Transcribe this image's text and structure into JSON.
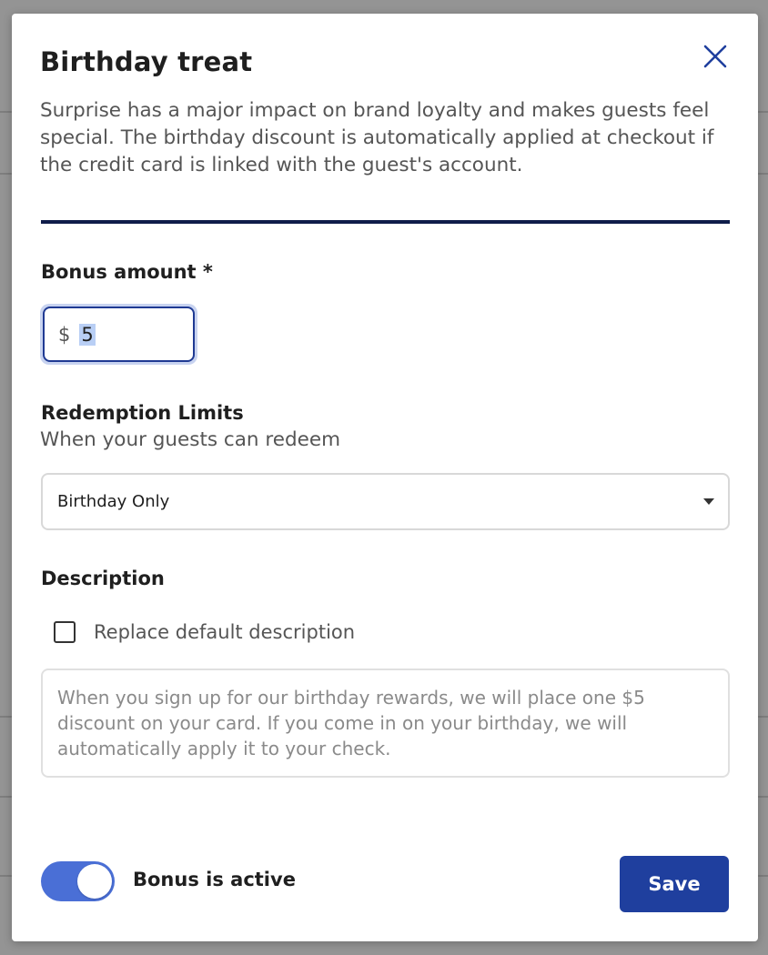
{
  "modal": {
    "title": "Birthday treat",
    "intro": "Surprise has a major impact on brand loyalty and makes guests feel special. The birthday discount is automatically applied at checkout if the credit card is linked with the guest's account."
  },
  "bonus_amount": {
    "label": "Bonus amount *",
    "prefix": "$",
    "value": "5"
  },
  "redemption": {
    "label": "Redemption Limits",
    "sublabel": "When your guests can redeem",
    "selected": "Birthday Only"
  },
  "description": {
    "label": "Description",
    "checkbox_label": "Replace default description",
    "checked": false,
    "text": "When you sign up for our birthday rewards, we will place one $5 discount on your card. If you come in on your birthday, we will automatically apply it to your check."
  },
  "footer": {
    "toggle_label": "Bonus is active",
    "toggle_on": true,
    "save_label": "Save"
  },
  "colors": {
    "accent": "#1f3f9e",
    "toggle": "#4a6fd6",
    "divider": "#0f1d4a"
  },
  "icons": {
    "close": "close-icon",
    "caret": "chevron-down-icon"
  }
}
